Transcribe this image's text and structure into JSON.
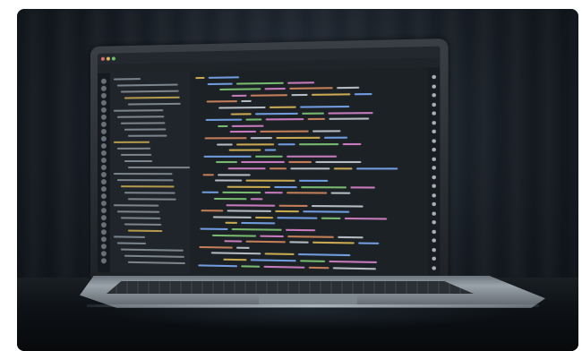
{
  "scene": {
    "subject": "laptop-with-code-editor",
    "screen_theme": "dark",
    "accent_colors": [
      "#e6c15a",
      "#7fb2ff",
      "#87d37c",
      "#e58ad6",
      "#e08e62",
      "#cfd6dc"
    ]
  }
}
